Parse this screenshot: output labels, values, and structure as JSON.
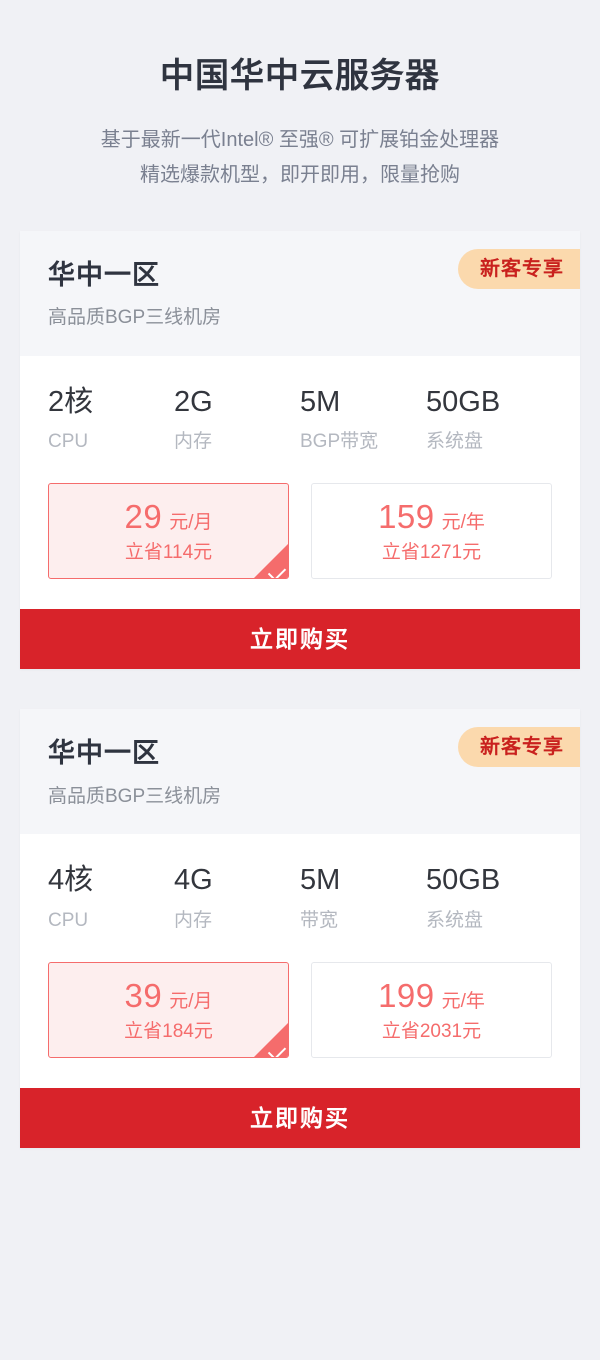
{
  "hero": {
    "title": "中国华中云服务器",
    "subtitle_line1": "基于最新一代Intel® 至强® 可扩展铂金处理器",
    "subtitle_line2": "精选爆款机型，即开即用，限量抢购"
  },
  "colors": {
    "page_background": "#f0f1f5",
    "card_header_background": "#f5f6f9",
    "badge_background": "#fbd9ad",
    "badge_text": "#c9211e",
    "price_red": "#f56c6c",
    "selected_price_background": "#fdeeee",
    "buy_button": "#d8232a",
    "title_text": "#2f3440",
    "muted_text": "#8b9099"
  },
  "cards": [
    {
      "region": "华中一区",
      "description": "高品质BGP三线机房",
      "badge": "新客专享",
      "specs": [
        {
          "value": "2核",
          "label": "CPU"
        },
        {
          "value": "2G",
          "label": "内存"
        },
        {
          "value": "5M",
          "label": "BGP带宽"
        },
        {
          "value": "50GB",
          "label": "系统盘"
        }
      ],
      "prices": [
        {
          "amount": "29",
          "unit": "元/月",
          "save": "立省114元",
          "selected": true
        },
        {
          "amount": "159",
          "unit": "元/年",
          "save": "立省1271元",
          "selected": false
        }
      ],
      "buy_label": "立即购买"
    },
    {
      "region": "华中一区",
      "description": "高品质BGP三线机房",
      "badge": "新客专享",
      "specs": [
        {
          "value": "4核",
          "label": "CPU"
        },
        {
          "value": "4G",
          "label": "内存"
        },
        {
          "value": "5M",
          "label": "带宽"
        },
        {
          "value": "50GB",
          "label": "系统盘"
        }
      ],
      "prices": [
        {
          "amount": "39",
          "unit": "元/月",
          "save": "立省184元",
          "selected": true
        },
        {
          "amount": "199",
          "unit": "元/年",
          "save": "立省2031元",
          "selected": false
        }
      ],
      "buy_label": "立即购买"
    }
  ]
}
